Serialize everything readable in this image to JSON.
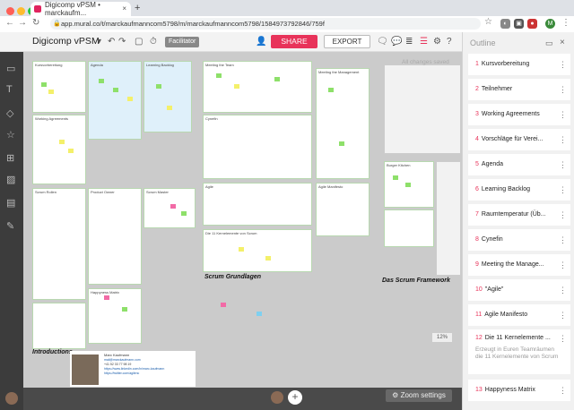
{
  "browser": {
    "tab_title": "Digicomp vPSM • marckaufm...",
    "url": "app.mural.co/t/marckaufmanncom5798/m/marckaufmanncom5798/1584973792846/759f",
    "new_tab": "+",
    "profile_initial": "M"
  },
  "toolbar": {
    "board_title": "Digicomp vPSM",
    "facilitator_label": "Facilitator",
    "share_label": "SHARE",
    "export_label": "EXPORT",
    "share_color": "#e8335a"
  },
  "canvas": {
    "status": "All changes saved",
    "zoom_percent": "12%",
    "labels": {
      "scrum_grundlagen": "Scrum Grundlagen",
      "scrum_framework": "Das Scrum Framework",
      "introductions": "Introductions"
    },
    "contact_card": {
      "name": "Marc Kaufmann",
      "lines": [
        "mail@marckaufmann.com",
        "+41 52 33 77 98 19",
        "https://www.linkedin.com/in/marc-kaufmann",
        "https://twitter.com/agilenc"
      ]
    },
    "frames": [
      "Kursvorbereitung",
      "Agenda",
      "Learning Backlog",
      "Meeting the Team",
      "Meeting the Management",
      "Working Agreements",
      "Cynefin",
      "Agile",
      "Agile Manifesto",
      "Die 11 Kernelemente von Scrum",
      "Scrum Rollen",
      "Product Owner",
      "Scrum Master",
      "Happyness Matrix",
      "Burger Kitchen"
    ]
  },
  "bottom": {
    "zoom_settings_label": "Zoom settings",
    "add_label": "+"
  },
  "outline": {
    "header": "Outline",
    "items": [
      {
        "num": "1",
        "label": "Kursvorbereitung"
      },
      {
        "num": "2",
        "label": "Teilnehmer"
      },
      {
        "num": "3",
        "label": "Working Agreements"
      },
      {
        "num": "4",
        "label": "Vorschläge für Verei..."
      },
      {
        "num": "5",
        "label": "Agenda"
      },
      {
        "num": "6",
        "label": "Learning Backlog"
      },
      {
        "num": "7",
        "label": "Raumtemperatur (Üb..."
      },
      {
        "num": "8",
        "label": "Cynefin"
      },
      {
        "num": "9",
        "label": "Meeting the Manage..."
      },
      {
        "num": "10",
        "label": "\"Agile\""
      },
      {
        "num": "11",
        "label": "Agile Manifesto"
      },
      {
        "num": "12",
        "label": "Die 11 Kernelemente ...",
        "sub": "Erzeugt in Euren Teamräumen die 11 Kernelemente von Scrum"
      },
      {
        "num": "13",
        "label": "Happyness Matrix"
      }
    ]
  },
  "colors": {
    "sticky_yellow": "#f4f06a",
    "sticky_green": "#8ee06a",
    "sticky_pink": "#f26aa6",
    "sticky_blue": "#7fd0f0",
    "frame_border_green": "#b8d8b0"
  }
}
